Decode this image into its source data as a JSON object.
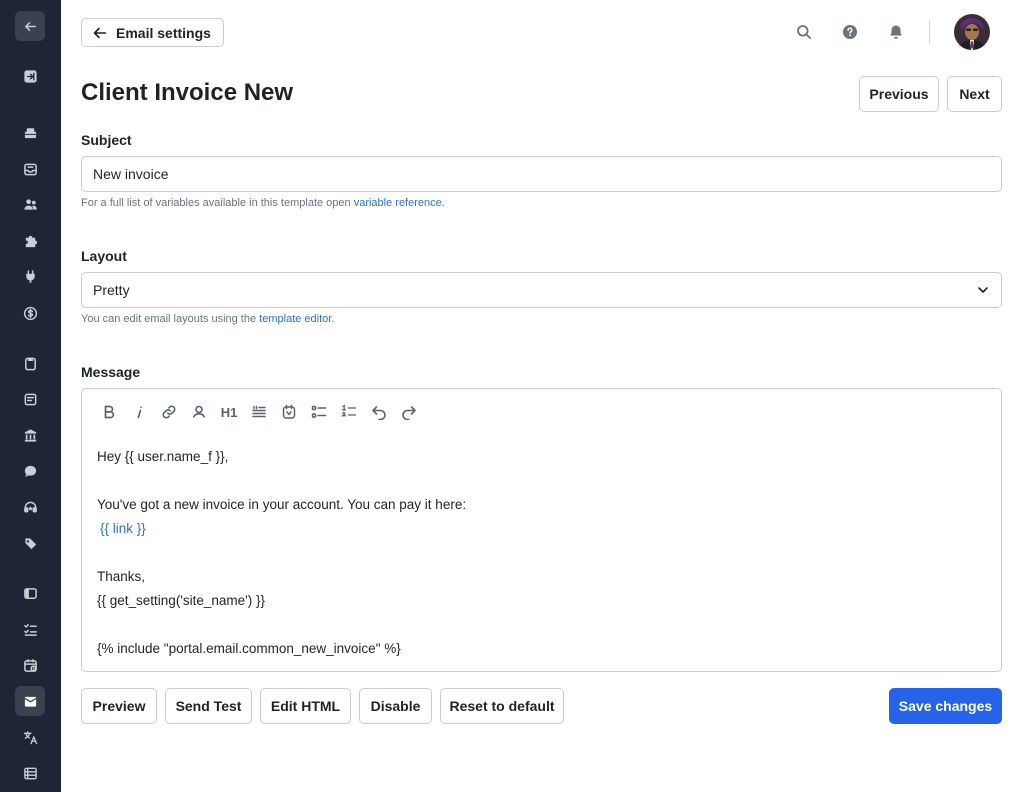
{
  "header": {
    "back_label": "Email settings",
    "icons": [
      "search-icon",
      "help-icon",
      "bell-icon"
    ]
  },
  "sidebar": {
    "items": [
      "back-arrow-icon",
      "collapse-icon",
      "cake-icon",
      "inbox-icon",
      "users-icon",
      "puzzle-icon",
      "plug-icon",
      "dollar-icon",
      "clipboard-icon",
      "document-icon",
      "bank-icon",
      "chat-icon",
      "support-icon",
      "tag-icon",
      "layout-icon",
      "checklist-icon",
      "calendar-icon",
      "email-icon",
      "translate-icon",
      "list-icon"
    ],
    "active": "email-icon"
  },
  "page": {
    "title": "Client Invoice New",
    "previous_label": "Previous",
    "next_label": "Next"
  },
  "subject": {
    "label": "Subject",
    "value": "New invoice",
    "help_prefix": "For a full list of variables available in this template open",
    "help_link": "variable reference",
    "help_suffix": "."
  },
  "layout": {
    "label": "Layout",
    "selected": "Pretty",
    "help_prefix": "You can edit email layouts using the",
    "help_link": "template editor",
    "help_suffix": "."
  },
  "message": {
    "label": "Message",
    "toolbar": [
      "bold-icon",
      "italic-icon",
      "link-icon",
      "user-icon",
      "H1",
      "quote-icon",
      "variable-icon",
      "bullet-list-icon",
      "numbered-list-icon",
      "undo-icon",
      "redo-icon"
    ],
    "h1_label": "H1",
    "lines": {
      "greeting": "Hey {{ user.name_f }},",
      "body": "You've got a new invoice in your account. You can pay it here:",
      "link": "{{ link }}",
      "thanks": "Thanks,",
      "site": "{{ get_setting('site_name') }}",
      "include": "{% include \"portal.email.common_new_invoice\" %}"
    }
  },
  "actions": {
    "preview": "Preview",
    "send_test": "Send Test",
    "edit_html": "Edit HTML",
    "disable": "Disable",
    "reset": "Reset to default",
    "save": "Save changes"
  },
  "colors": {
    "sidebar_bg": "#1e2636",
    "accent": "#2563eb",
    "link": "#2f6fd6"
  }
}
